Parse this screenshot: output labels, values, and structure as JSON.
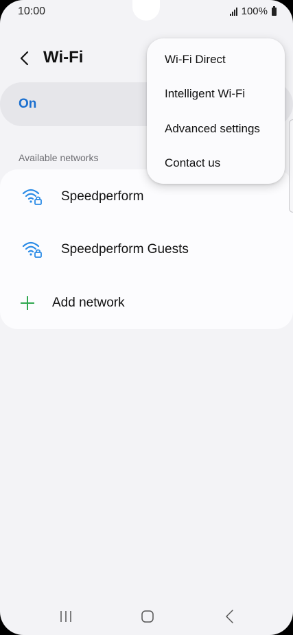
{
  "status_bar": {
    "time": "10:00",
    "battery": "100%"
  },
  "header": {
    "title": "Wi-Fi",
    "back_icon": "back-chevron-icon"
  },
  "toggle": {
    "label": "On",
    "accent_color": "#1a6fcf"
  },
  "networks": {
    "section_label": "Available networks",
    "items": [
      {
        "name": "Speedperform",
        "icon": "wifi-locked-icon"
      },
      {
        "name": "Speedperform Guests",
        "icon": "wifi-locked-icon"
      }
    ],
    "add_label": "Add network",
    "add_icon": "plus-icon",
    "icon_color": "#2a8be6",
    "plus_color": "#2fa84f"
  },
  "menu": {
    "items": [
      {
        "label": "Wi-Fi Direct"
      },
      {
        "label": "Intelligent Wi-Fi"
      },
      {
        "label": "Advanced settings"
      },
      {
        "label": "Contact us"
      }
    ]
  },
  "nav_bar": {
    "recents_icon": "recents-icon",
    "home_icon": "home-icon",
    "back_icon": "nav-back-icon"
  }
}
